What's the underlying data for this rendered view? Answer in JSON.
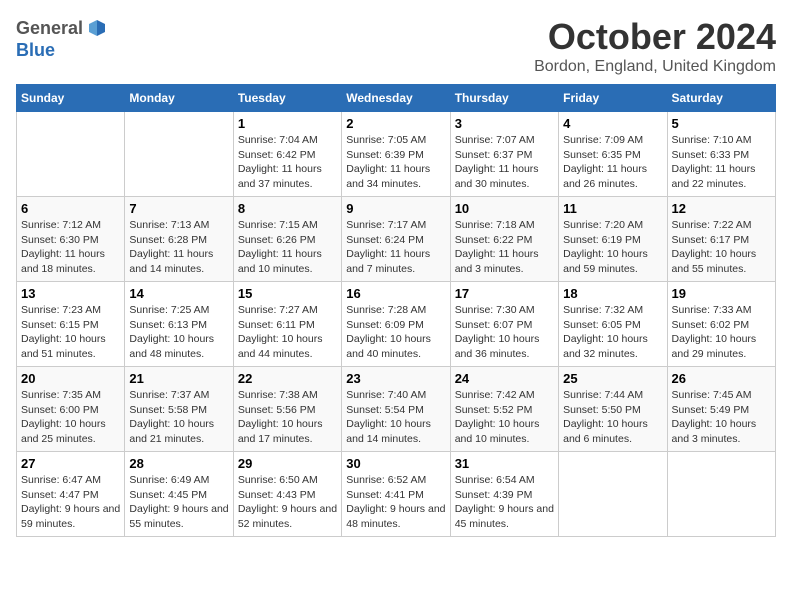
{
  "header": {
    "logo_general": "General",
    "logo_blue": "Blue",
    "title": "October 2024",
    "location": "Bordon, England, United Kingdom"
  },
  "days_of_week": [
    "Sunday",
    "Monday",
    "Tuesday",
    "Wednesday",
    "Thursday",
    "Friday",
    "Saturday"
  ],
  "weeks": [
    [
      {
        "day": "",
        "content": ""
      },
      {
        "day": "",
        "content": ""
      },
      {
        "day": "1",
        "content": "Sunrise: 7:04 AM\nSunset: 6:42 PM\nDaylight: 11 hours and 37 minutes."
      },
      {
        "day": "2",
        "content": "Sunrise: 7:05 AM\nSunset: 6:39 PM\nDaylight: 11 hours and 34 minutes."
      },
      {
        "day": "3",
        "content": "Sunrise: 7:07 AM\nSunset: 6:37 PM\nDaylight: 11 hours and 30 minutes."
      },
      {
        "day": "4",
        "content": "Sunrise: 7:09 AM\nSunset: 6:35 PM\nDaylight: 11 hours and 26 minutes."
      },
      {
        "day": "5",
        "content": "Sunrise: 7:10 AM\nSunset: 6:33 PM\nDaylight: 11 hours and 22 minutes."
      }
    ],
    [
      {
        "day": "6",
        "content": "Sunrise: 7:12 AM\nSunset: 6:30 PM\nDaylight: 11 hours and 18 minutes."
      },
      {
        "day": "7",
        "content": "Sunrise: 7:13 AM\nSunset: 6:28 PM\nDaylight: 11 hours and 14 minutes."
      },
      {
        "day": "8",
        "content": "Sunrise: 7:15 AM\nSunset: 6:26 PM\nDaylight: 11 hours and 10 minutes."
      },
      {
        "day": "9",
        "content": "Sunrise: 7:17 AM\nSunset: 6:24 PM\nDaylight: 11 hours and 7 minutes."
      },
      {
        "day": "10",
        "content": "Sunrise: 7:18 AM\nSunset: 6:22 PM\nDaylight: 11 hours and 3 minutes."
      },
      {
        "day": "11",
        "content": "Sunrise: 7:20 AM\nSunset: 6:19 PM\nDaylight: 10 hours and 59 minutes."
      },
      {
        "day": "12",
        "content": "Sunrise: 7:22 AM\nSunset: 6:17 PM\nDaylight: 10 hours and 55 minutes."
      }
    ],
    [
      {
        "day": "13",
        "content": "Sunrise: 7:23 AM\nSunset: 6:15 PM\nDaylight: 10 hours and 51 minutes."
      },
      {
        "day": "14",
        "content": "Sunrise: 7:25 AM\nSunset: 6:13 PM\nDaylight: 10 hours and 48 minutes."
      },
      {
        "day": "15",
        "content": "Sunrise: 7:27 AM\nSunset: 6:11 PM\nDaylight: 10 hours and 44 minutes."
      },
      {
        "day": "16",
        "content": "Sunrise: 7:28 AM\nSunset: 6:09 PM\nDaylight: 10 hours and 40 minutes."
      },
      {
        "day": "17",
        "content": "Sunrise: 7:30 AM\nSunset: 6:07 PM\nDaylight: 10 hours and 36 minutes."
      },
      {
        "day": "18",
        "content": "Sunrise: 7:32 AM\nSunset: 6:05 PM\nDaylight: 10 hours and 32 minutes."
      },
      {
        "day": "19",
        "content": "Sunrise: 7:33 AM\nSunset: 6:02 PM\nDaylight: 10 hours and 29 minutes."
      }
    ],
    [
      {
        "day": "20",
        "content": "Sunrise: 7:35 AM\nSunset: 6:00 PM\nDaylight: 10 hours and 25 minutes."
      },
      {
        "day": "21",
        "content": "Sunrise: 7:37 AM\nSunset: 5:58 PM\nDaylight: 10 hours and 21 minutes."
      },
      {
        "day": "22",
        "content": "Sunrise: 7:38 AM\nSunset: 5:56 PM\nDaylight: 10 hours and 17 minutes."
      },
      {
        "day": "23",
        "content": "Sunrise: 7:40 AM\nSunset: 5:54 PM\nDaylight: 10 hours and 14 minutes."
      },
      {
        "day": "24",
        "content": "Sunrise: 7:42 AM\nSunset: 5:52 PM\nDaylight: 10 hours and 10 minutes."
      },
      {
        "day": "25",
        "content": "Sunrise: 7:44 AM\nSunset: 5:50 PM\nDaylight: 10 hours and 6 minutes."
      },
      {
        "day": "26",
        "content": "Sunrise: 7:45 AM\nSunset: 5:49 PM\nDaylight: 10 hours and 3 minutes."
      }
    ],
    [
      {
        "day": "27",
        "content": "Sunrise: 6:47 AM\nSunset: 4:47 PM\nDaylight: 9 hours and 59 minutes."
      },
      {
        "day": "28",
        "content": "Sunrise: 6:49 AM\nSunset: 4:45 PM\nDaylight: 9 hours and 55 minutes."
      },
      {
        "day": "29",
        "content": "Sunrise: 6:50 AM\nSunset: 4:43 PM\nDaylight: 9 hours and 52 minutes."
      },
      {
        "day": "30",
        "content": "Sunrise: 6:52 AM\nSunset: 4:41 PM\nDaylight: 9 hours and 48 minutes."
      },
      {
        "day": "31",
        "content": "Sunrise: 6:54 AM\nSunset: 4:39 PM\nDaylight: 9 hours and 45 minutes."
      },
      {
        "day": "",
        "content": ""
      },
      {
        "day": "",
        "content": ""
      }
    ]
  ]
}
